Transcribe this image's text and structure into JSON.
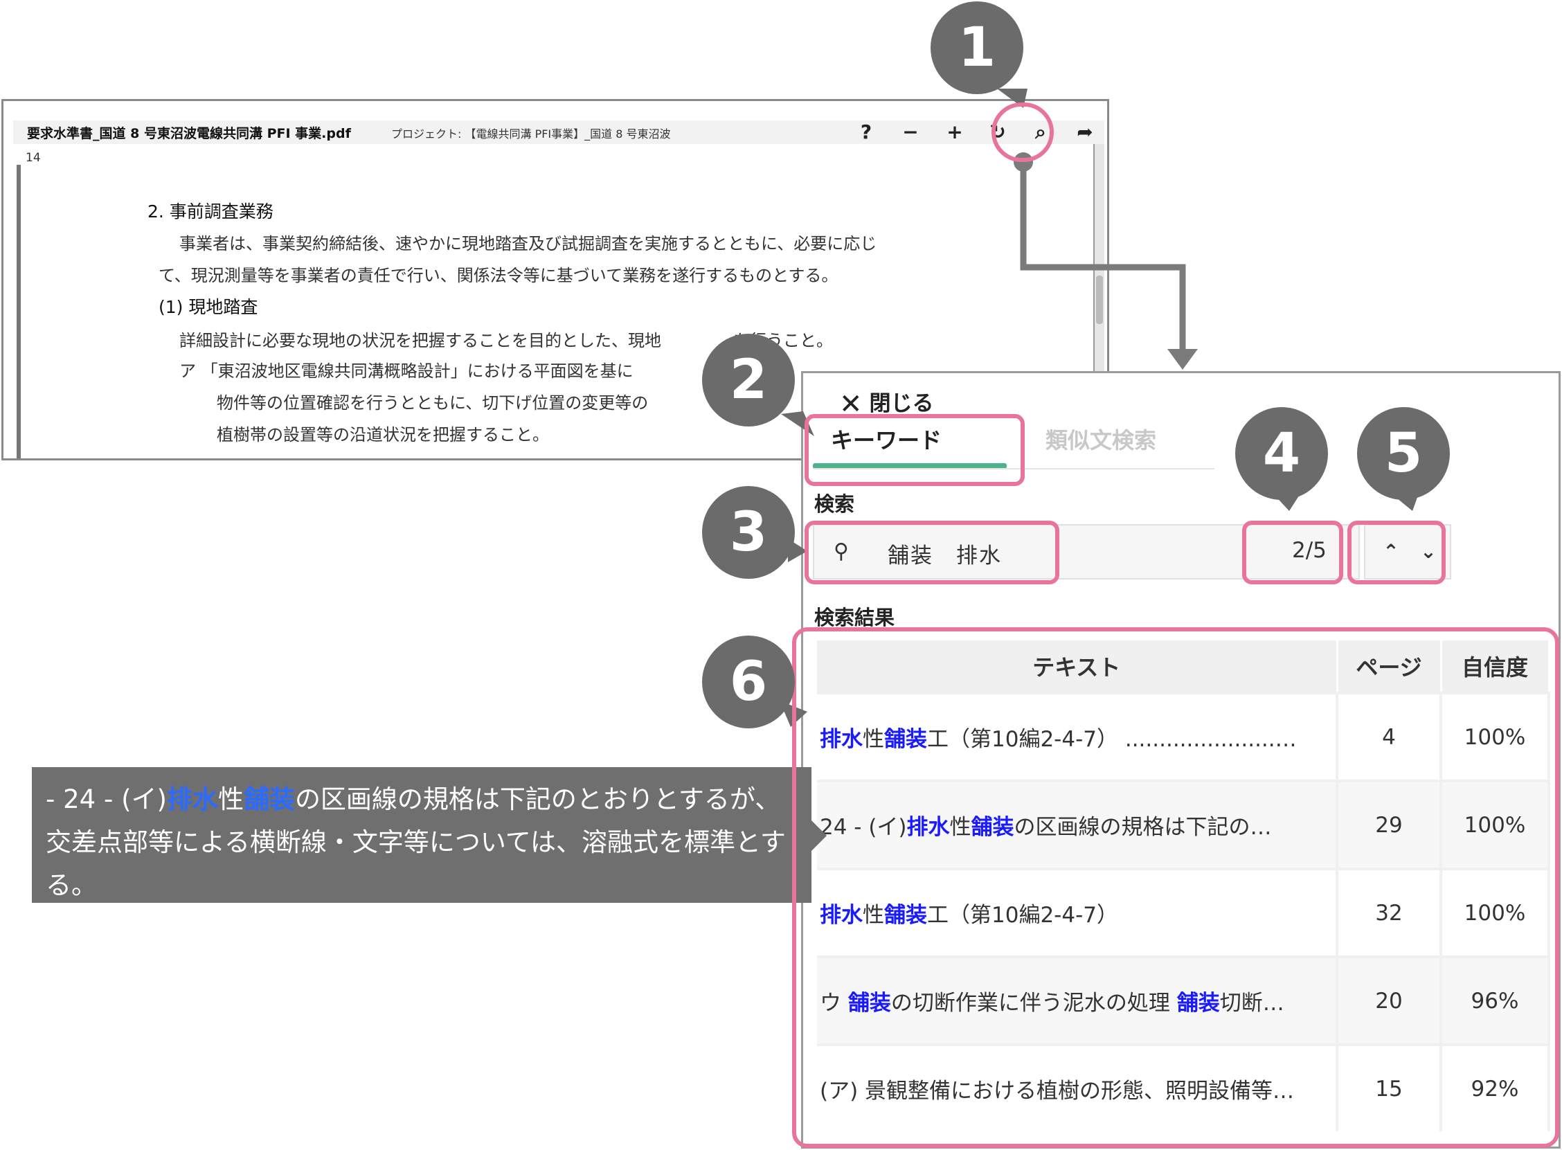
{
  "viewer": {
    "title": "要求水準書_国道 8 号東沼波電線共同溝 PFI 事業.pdf",
    "project": "プロジェクト: 【電線共同溝 PFI事業】_国道 8 号東沼波",
    "toolbar_icons": [
      "help-icon",
      "zoom-out-icon",
      "zoom-in-icon",
      "rotate-icon",
      "search-icon",
      "share-icon"
    ],
    "toolbar_glyphs": {
      "help": "?",
      "zoom_out": "−",
      "zoom_in": "+",
      "rotate": "↻",
      "search": "⌕",
      "share": "➦"
    },
    "page_number": "14",
    "document": {
      "heading": "2. 事前調査業務",
      "line1": "事業者は、事業契約締結後、速やかに現地踏査及び試掘調査を実施するとともに、必要に応じ",
      "line2": "て、現況測量等を事業者の責任で行い、関係法令等に基づいて業務を遂行するものとする。",
      "subheading": "(1) 現地踏査",
      "line3": "詳細設計に必要な現地の状況を把握することを目的とした、現地",
      "line3b": "を行うこと。",
      "line4": "ア 「東沼波地区電線共同溝概略設計」における平面図を基に",
      "line5": "物件等の位置確認を行うとともに、切下げ位置の変更等の",
      "line6": "植樹帯の設置等の沿道状況を把握すること。"
    }
  },
  "panel": {
    "close_label": "閉じる",
    "tabs": [
      {
        "label": "キーワード",
        "active": true
      },
      {
        "label": "類似文検索",
        "active": false
      }
    ],
    "search_label": "検索",
    "search_value": "舗装　排水",
    "counter": "2/5",
    "nav_up": "⌃",
    "nav_down": "⌄",
    "results_label": "検索結果",
    "columns": [
      "テキスト",
      "ページ",
      "自信度"
    ],
    "rows": [
      {
        "text": [
          [
            "排水",
            true
          ],
          [
            "性",
            false
          ],
          [
            "舗装",
            true
          ],
          [
            "工（第10編2-4-7） ......................…",
            false
          ]
        ],
        "page": "4",
        "confidence": "100%"
      },
      {
        "text": [
          [
            " 24 - (イ)",
            false
          ],
          [
            "排水",
            true
          ],
          [
            "性",
            false
          ],
          [
            "舗装",
            true
          ],
          [
            "の区画線の規格は下記の…",
            false
          ]
        ],
        "page": "29",
        "confidence": "100%"
      },
      {
        "text": [
          [
            "排水",
            true
          ],
          [
            "性",
            false
          ],
          [
            "舗装",
            true
          ],
          [
            "工（第10編2-4-7）",
            false
          ]
        ],
        "page": "32",
        "confidence": "100%"
      },
      {
        "text": [
          [
            "ウ ",
            false
          ],
          [
            "舗装",
            true
          ],
          [
            "の切断作業に伴う泥水の処理 ",
            false
          ],
          [
            "舗装",
            true
          ],
          [
            "切断…",
            false
          ]
        ],
        "page": "20",
        "confidence": "96%"
      },
      {
        "text": [
          [
            "(ア) 景観整備における植樹の形態、照明設備等…",
            false
          ]
        ],
        "page": "15",
        "confidence": "92%"
      }
    ]
  },
  "tooltip": {
    "segments": [
      [
        "- 24 - (イ)",
        false
      ],
      [
        "排水",
        true
      ],
      [
        "性",
        false
      ],
      [
        "舗装",
        true
      ],
      [
        "の区画線の規格は下記のとおりとするが、交差点部等による横断線・文字等については、溶融式を標準とする。",
        false
      ]
    ]
  },
  "callouts": [
    "1",
    "2",
    "3",
    "4",
    "5",
    "6"
  ],
  "colors": {
    "accent_pink": "#e8749d",
    "badge_gray": "#6b6b6b",
    "highlight_blue": "#1a1aff",
    "tab_green": "#4cb38a"
  }
}
